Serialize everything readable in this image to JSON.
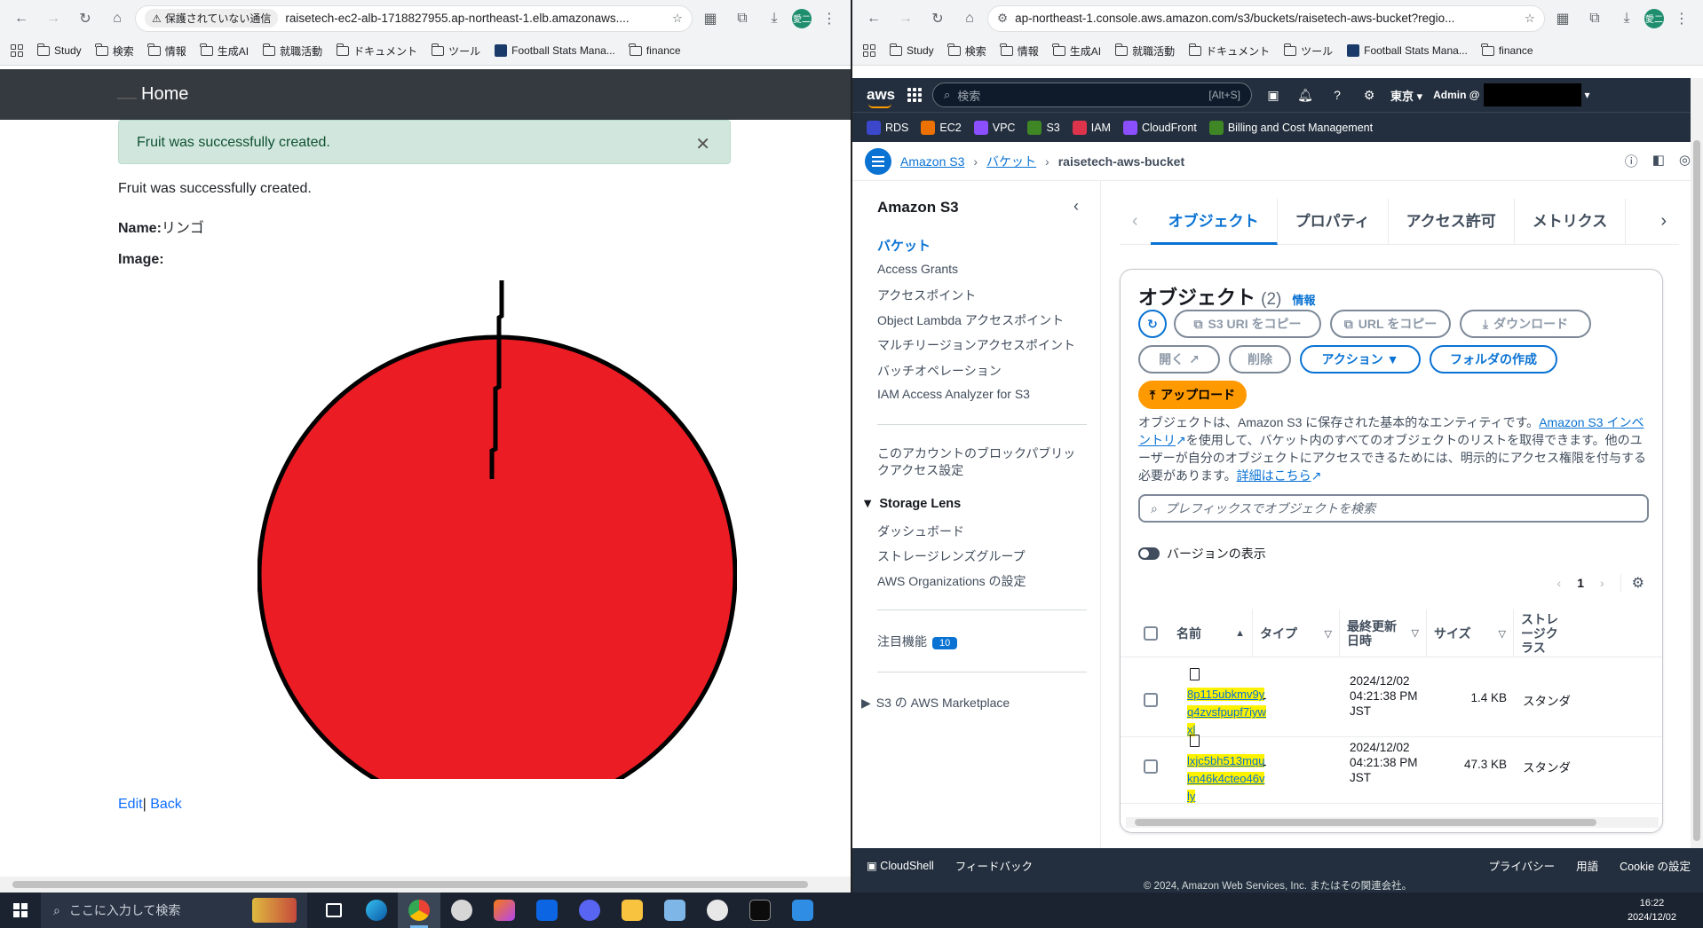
{
  "left_browser": {
    "security_label": "保護されていない通信",
    "url": "raisetech-ec2-alb-1718827955.ap-northeast-1.elb.amazonaws....",
    "avatar": "愛二",
    "bookmarks": [
      "Study",
      "検索",
      "情報",
      "生成AI",
      "就職活動",
      "ドキュメント",
      "ツール",
      "Football Stats Mana...",
      "finance"
    ],
    "page": {
      "nav_brand": "Home",
      "alert_text": "Fruit was successfully created.",
      "notice": "Fruit was successfully created.",
      "name_label": "Name:",
      "name_value": "リンゴ",
      "image_label": "Image:",
      "image_description": "red apple drawing",
      "edit_link": "Edit",
      "separator": "|",
      "back_link": "Back"
    }
  },
  "right_browser": {
    "url": "ap-northeast-1.console.aws.amazon.com/s3/buckets/raisetech-aws-bucket?regio...",
    "avatar": "愛二",
    "bookmarks": [
      "Study",
      "検索",
      "情報",
      "生成AI",
      "就職活動",
      "ドキュメント",
      "ツール",
      "Football Stats Mana...",
      "finance"
    ],
    "topbar": {
      "logo": "aws",
      "search_placeholder": "検索",
      "search_shortcut": "[Alt+S]",
      "region": "東京 ▾",
      "account": "Admin @"
    },
    "services": [
      {
        "label": "RDS",
        "color": "#3b48cc"
      },
      {
        "label": "EC2",
        "color": "#ed7100"
      },
      {
        "label": "VPC",
        "color": "#8c4fff"
      },
      {
        "label": "S3",
        "color": "#3f8624"
      },
      {
        "label": "IAM",
        "color": "#dd344c"
      },
      {
        "label": "CloudFront",
        "color": "#8c4fff"
      },
      {
        "label": "Billing and Cost Management",
        "color": "#3f8624"
      }
    ],
    "breadcrumb": {
      "root": "Amazon S3",
      "buckets": "バケット",
      "current": "raisetech-aws-bucket"
    },
    "sidenav": {
      "title": "Amazon S3",
      "items": [
        "バケット",
        "Access Grants",
        "アクセスポイント",
        "Object Lambda アクセスポイント",
        "マルチリージョンアクセスポイント",
        "バッチオペレーション",
        "IAM Access Analyzer for S3"
      ],
      "block_public_access": "このアカウントのブロックパブリックアクセス設定",
      "storage_lens": "Storage Lens",
      "lens_items": [
        "ダッシュボード",
        "ストレージレンズグループ",
        "AWS Organizations の設定"
      ],
      "featured": "注目機能",
      "featured_count": "10",
      "marketplace": "S3 の AWS Marketplace"
    },
    "tabs": [
      "オブジェクト",
      "プロパティ",
      "アクセス許可",
      "メトリクス"
    ],
    "objects": {
      "title": "オブジェクト",
      "count": "(2)",
      "info": "情報",
      "buttons": {
        "copy_uri": "S3 URI をコピー",
        "copy_url": "URL をコピー",
        "download": "ダウンロード",
        "open": "開く",
        "delete": "削除",
        "actions": "アクション ▼",
        "create_folder": "フォルダの作成",
        "upload": "アップロード"
      },
      "description_1": "オブジェクトは、Amazon S3 に保存された基本的なエンティティです。",
      "description_link": "Amazon S3 インベントリ",
      "description_2": "を使用して、バケット内のすべてのオブジェクトのリストを取得できます。他のユーザーが自分のオブジェクトにアクセスできるためには、明示的にアクセス権限を付与する必要があります。",
      "description_more": "詳細はこちら",
      "search_placeholder": "プレフィックスでオブジェクトを検索",
      "version_toggle": "バージョンの表示",
      "page": "1",
      "columns": [
        "名前",
        "タイプ",
        "最終更新日時",
        "サイズ",
        "ストレージクラス"
      ],
      "rows": [
        {
          "name": "8p115ubkmv9yq4zvsfpupf7iywxl",
          "type": "-",
          "modified": "2024/12/02 04:21:38 PM JST",
          "size": "1.4 KB",
          "storage": "スタンダ"
        },
        {
          "name": "lxjc5bh513mqukn46k4cteo46vly",
          "type": "-",
          "modified": "2024/12/02 04:21:38 PM JST",
          "size": "47.3 KB",
          "storage": "スタンダ"
        }
      ]
    },
    "footer": {
      "cloudshell": "CloudShell",
      "feedback": "フィードバック",
      "privacy": "プライバシー",
      "terms": "用語",
      "cookie": "Cookie の設定",
      "copyright": "© 2024, Amazon Web Services, Inc. またはその関連会社。"
    }
  },
  "taskbar": {
    "search_placeholder": "ここに入力して検索",
    "time": "16:22",
    "date": "2024/12/02"
  }
}
